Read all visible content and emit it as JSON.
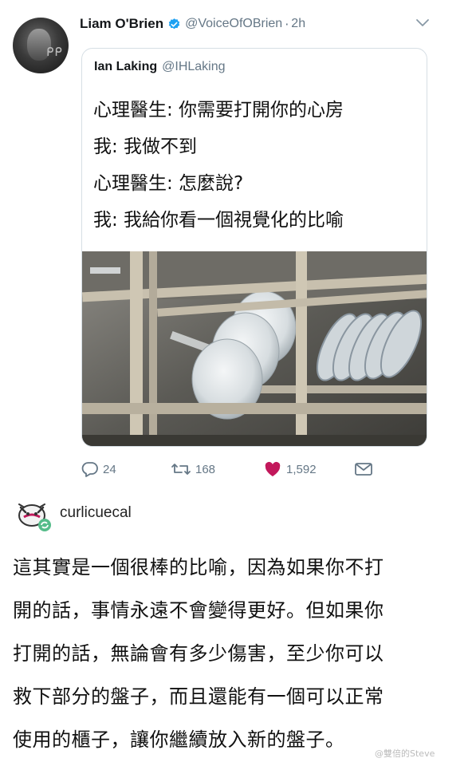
{
  "tweet": {
    "author_name": "Liam O'Brien",
    "author_handle": "@VoiceOfOBrien",
    "separator": "·",
    "time": "2h",
    "avatar_icon": "person-photo",
    "verified_color": "#1da1f2",
    "quoted": {
      "author_name": "Ian Laking",
      "author_handle": "@IHLaking",
      "lines": [
        "心理醫生: 你需要打開你的心房",
        "我: 我做不到",
        "心理醫生: 怎麼說?",
        "我: 我給你看一個視覺化的比喻"
      ],
      "image_icon": "cupboard-with-stacked-plates-photo"
    },
    "actions": {
      "reply_count": "24",
      "retweet_count": "168",
      "like_count": "1,592",
      "like_color": "#c2185b"
    }
  },
  "tumblr_post": {
    "username": "curlicuecal",
    "avatar_icon": "cartoon-mascot-avatar",
    "lines": [
      "這其實是一個很棒的比喻，因為如果你不打",
      "開的話，事情永遠不會變得更好。但如果你",
      "打開的話，無論會有多少傷害，至少你可以",
      "救下部分的盤子，而且還能有一個可以正常",
      "使用的櫃子，讓你繼續放入新的盤子。"
    ]
  },
  "watermark": "@雙倍的Steve"
}
